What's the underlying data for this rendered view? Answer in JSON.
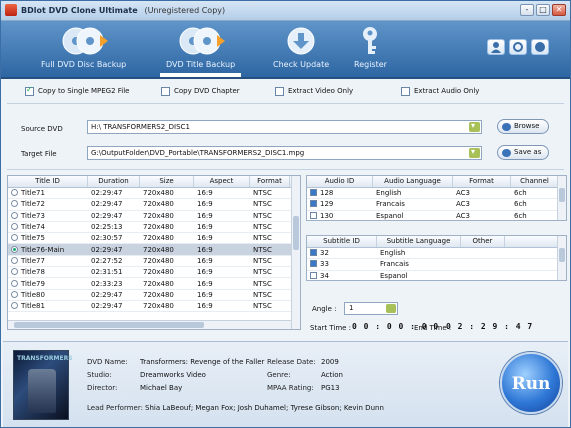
{
  "app": {
    "title": "BDlot DVD Clone Ultimate",
    "subtitle": "(Unregistered Copy)"
  },
  "window_buttons": [
    "-",
    "□",
    "✕"
  ],
  "toolbar": {
    "items": [
      {
        "label": "Full DVD Disc Backup"
      },
      {
        "label": "DVD Title Backup"
      },
      {
        "label": "Check Update"
      },
      {
        "label": "Register"
      }
    ]
  },
  "options": {
    "copy_single_mpeg2": {
      "label": "Copy to Single MPEG2 File",
      "checked": true
    },
    "copy_dvd_chapter": {
      "label": "Copy DVD Chapter",
      "checked": false
    },
    "extract_video": {
      "label": "Extract Video Only",
      "checked": false
    },
    "extract_audio": {
      "label": "Extract Audio Only",
      "checked": false
    }
  },
  "source": {
    "label": "Source DVD",
    "value": "H:\\ TRANSFORMERS2_DISC1",
    "button": "Browse"
  },
  "target": {
    "label": "Target File",
    "value": "G:\\OutputFolder\\DVD_Portable\\TRANSFORMERS2_DISC1.mpg",
    "button": "Save as"
  },
  "titles": {
    "headers": [
      "Title ID",
      "Duration",
      "Size",
      "Aspect",
      "Format"
    ],
    "rows": [
      [
        "Title71",
        "02:29:47",
        "720x480",
        "16:9",
        "NTSC"
      ],
      [
        "Title72",
        "02:29:47",
        "720x480",
        "16:9",
        "NTSC"
      ],
      [
        "Title73",
        "02:29:47",
        "720x480",
        "16:9",
        "NTSC"
      ],
      [
        "Title74",
        "02:25:13",
        "720x480",
        "16:9",
        "NTSC"
      ],
      [
        "Title75",
        "02:30:57",
        "720x480",
        "16:9",
        "NTSC"
      ],
      [
        "Title76-Main",
        "02:29:47",
        "720x480",
        "16:9",
        "NTSC"
      ],
      [
        "Title77",
        "02:27:52",
        "720x480",
        "16:9",
        "NTSC"
      ],
      [
        "Title78",
        "02:31:51",
        "720x480",
        "16:9",
        "NTSC"
      ],
      [
        "Title79",
        "02:33:23",
        "720x480",
        "16:9",
        "NTSC"
      ],
      [
        "Title80",
        "02:29:47",
        "720x480",
        "16:9",
        "NTSC"
      ],
      [
        "Title81",
        "02:29:47",
        "720x480",
        "16:9",
        "NTSC"
      ]
    ],
    "selected_index": 5
  },
  "audio": {
    "headers": [
      "Audio ID",
      "Audio Language",
      "Format",
      "Channel"
    ],
    "rows": [
      [
        "128",
        "English",
        "AC3",
        "6ch"
      ],
      [
        "129",
        "Francais",
        "AC3",
        "6ch"
      ],
      [
        "130",
        "Espanol",
        "AC3",
        "6ch"
      ]
    ]
  },
  "subtitle": {
    "headers": [
      "Subtitle ID",
      "Subtitle Language",
      "Other"
    ],
    "rows": [
      [
        "32",
        "English",
        ""
      ],
      [
        "33",
        "Francais",
        ""
      ],
      [
        "34",
        "Espanol",
        ""
      ]
    ]
  },
  "angle": {
    "label": "Angle :",
    "value": "1"
  },
  "time": {
    "start_label": "Start Time :",
    "start": "0 0 : 0 0 : 0 0",
    "end_label": "End Time :",
    "end": "0 2 : 2 9 : 4 7"
  },
  "info": {
    "cover_text": "TRANSFORMERS",
    "dvd_name_label": "DVD Name:",
    "dvd_name": "Transformers: Revenge of the Faller",
    "studio_label": "Studio:",
    "studio": "Dreamworks Video",
    "director_label": "Director:",
    "director": "Michael Bay",
    "release_label": "Release Date:",
    "release": "2009",
    "genre_label": "Genre:",
    "genre": "Action",
    "mpaa_label": "MPAA Rating:",
    "mpaa": "PG13",
    "performer_label": "Lead Performer:",
    "performer": "Shia LaBeouf; Megan Fox; Josh Duhamel; Tyrese Gibson; Kevin Dunn"
  },
  "run": {
    "label": "Run"
  }
}
